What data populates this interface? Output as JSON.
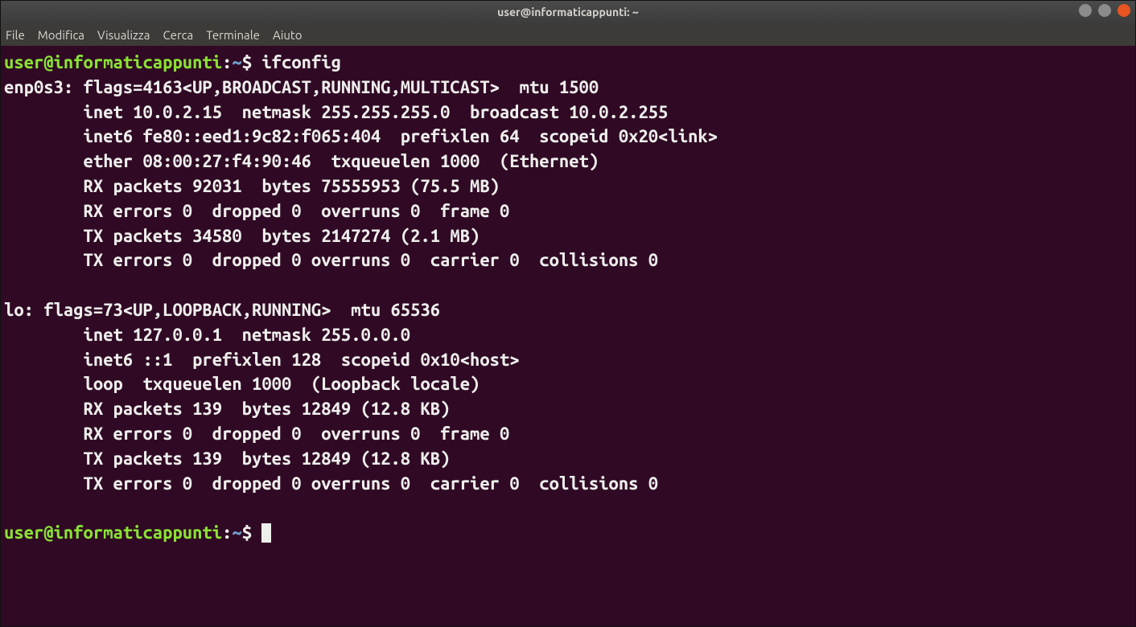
{
  "window": {
    "title": "user@informaticappunti: ~"
  },
  "menubar": {
    "items": [
      "File",
      "Modifica",
      "Visualizza",
      "Cerca",
      "Terminale",
      "Aiuto"
    ]
  },
  "prompt": {
    "userhost": "user@informaticappunti",
    "sep": ":",
    "path": "~",
    "dollar": "$"
  },
  "command": "ifconfig",
  "output": {
    "l0": "enp0s3: flags=4163<UP,BROADCAST,RUNNING,MULTICAST>  mtu 1500",
    "l1": "        inet 10.0.2.15  netmask 255.255.255.0  broadcast 10.0.2.255",
    "l2": "        inet6 fe80::eed1:9c82:f065:404  prefixlen 64  scopeid 0x20<link>",
    "l3": "        ether 08:00:27:f4:90:46  txqueuelen 1000  (Ethernet)",
    "l4": "        RX packets 92031  bytes 75555953 (75.5 MB)",
    "l5": "        RX errors 0  dropped 0  overruns 0  frame 0",
    "l6": "        TX packets 34580  bytes 2147274 (2.1 MB)",
    "l7": "        TX errors 0  dropped 0 overruns 0  carrier 0  collisions 0",
    "l8": "",
    "l9": "lo: flags=73<UP,LOOPBACK,RUNNING>  mtu 65536",
    "l10": "        inet 127.0.0.1  netmask 255.0.0.0",
    "l11": "        inet6 ::1  prefixlen 128  scopeid 0x10<host>",
    "l12": "        loop  txqueuelen 1000  (Loopback locale)",
    "l13": "        RX packets 139  bytes 12849 (12.8 KB)",
    "l14": "        RX errors 0  dropped 0  overruns 0  frame 0",
    "l15": "        TX packets 139  bytes 12849 (12.8 KB)",
    "l16": "        TX errors 0  dropped 0 overruns 0  carrier 0  collisions 0",
    "l17": ""
  }
}
